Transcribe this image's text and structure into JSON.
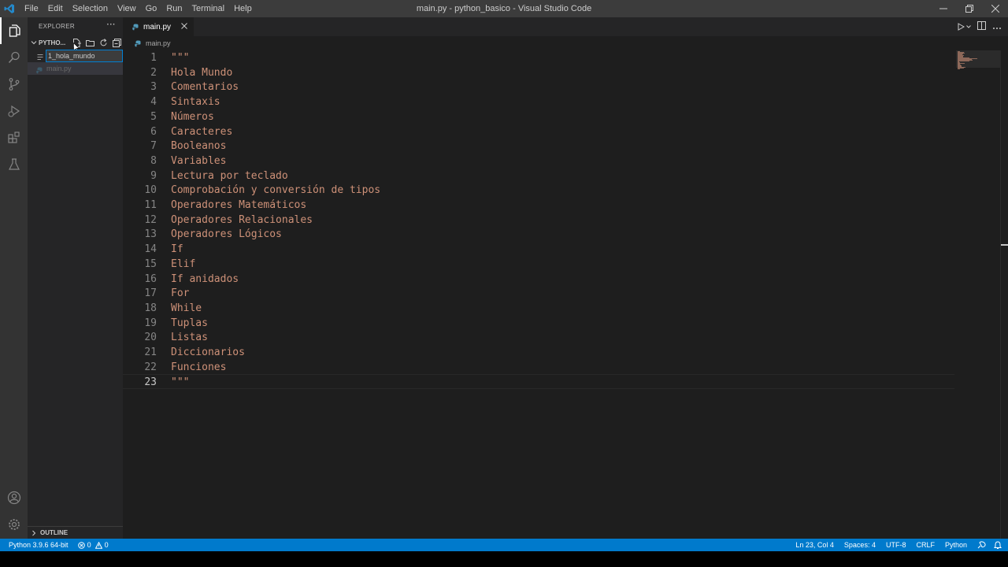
{
  "titlebar": {
    "menu": [
      "File",
      "Edit",
      "Selection",
      "View",
      "Go",
      "Run",
      "Terminal",
      "Help"
    ],
    "window_title": "main.py - python_basico - Visual Studio Code"
  },
  "sidebar": {
    "header": "EXPLORER",
    "more": "···",
    "folder_name": "PYTHO...",
    "rename_value": "1_hola_mundo",
    "file_name": "main.py",
    "outline_label": "OUTLINE"
  },
  "editor": {
    "tab_name": "main.py",
    "breadcrumb": "main.py",
    "lines": [
      {
        "n": "1",
        "text": "\"\"\""
      },
      {
        "n": "2",
        "text": "Hola Mundo"
      },
      {
        "n": "3",
        "text": "Comentarios"
      },
      {
        "n": "4",
        "text": "Sintaxis"
      },
      {
        "n": "5",
        "text": "Números"
      },
      {
        "n": "6",
        "text": "Caracteres"
      },
      {
        "n": "7",
        "text": "Booleanos"
      },
      {
        "n": "8",
        "text": "Variables"
      },
      {
        "n": "9",
        "text": "Lectura por teclado"
      },
      {
        "n": "10",
        "text": "Comprobación y conversión de tipos"
      },
      {
        "n": "11",
        "text": "Operadores Matemáticos"
      },
      {
        "n": "12",
        "text": "Operadores Relacionales"
      },
      {
        "n": "13",
        "text": "Operadores Lógicos"
      },
      {
        "n": "14",
        "text": "If"
      },
      {
        "n": "15",
        "text": "Elif"
      },
      {
        "n": "16",
        "text": "If anidados"
      },
      {
        "n": "17",
        "text": "For"
      },
      {
        "n": "18",
        "text": "While"
      },
      {
        "n": "19",
        "text": "Tuplas"
      },
      {
        "n": "20",
        "text": "Listas"
      },
      {
        "n": "21",
        "text": "Diccionarios"
      },
      {
        "n": "22",
        "text": "Funciones"
      },
      {
        "n": "23",
        "text": "\"\"\""
      }
    ]
  },
  "status": {
    "interpreter": "Python 3.9.6 64-bit",
    "errors": "0",
    "warnings": "0",
    "cursor": "Ln 23, Col 4",
    "spaces": "Spaces: 4",
    "encoding": "UTF-8",
    "eol": "CRLF",
    "language": "Python"
  },
  "colors": {
    "accent": "#007acc",
    "string": "#ce9178",
    "python_icon": "#519aba"
  }
}
